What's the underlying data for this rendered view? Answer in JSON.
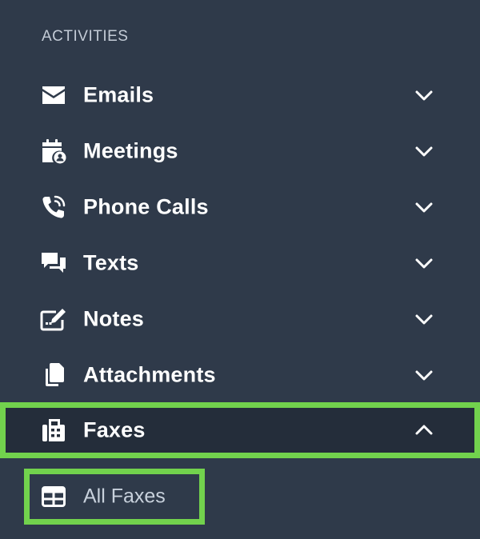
{
  "sidebar": {
    "section_heading": "ACTIVITIES",
    "items": [
      {
        "label": "Emails",
        "icon": "envelope-icon",
        "expanded": false
      },
      {
        "label": "Meetings",
        "icon": "calendar-user-icon",
        "expanded": false
      },
      {
        "label": "Phone Calls",
        "icon": "phone-wave-icon",
        "expanded": false
      },
      {
        "label": "Texts",
        "icon": "chat-bubbles-icon",
        "expanded": false
      },
      {
        "label": "Notes",
        "icon": "note-edit-icon",
        "expanded": false
      },
      {
        "label": "Attachments",
        "icon": "copy-files-icon",
        "expanded": false
      },
      {
        "label": "Faxes",
        "icon": "fax-machine-icon",
        "expanded": true
      }
    ],
    "sub_items": [
      {
        "label": "All Faxes",
        "icon": "table-grid-icon"
      }
    ]
  },
  "colors": {
    "background": "#2f3a4a",
    "active_background": "#242d3a",
    "highlight": "#72d24d",
    "text": "#ffffff",
    "heading_text": "#c3cbd6"
  }
}
